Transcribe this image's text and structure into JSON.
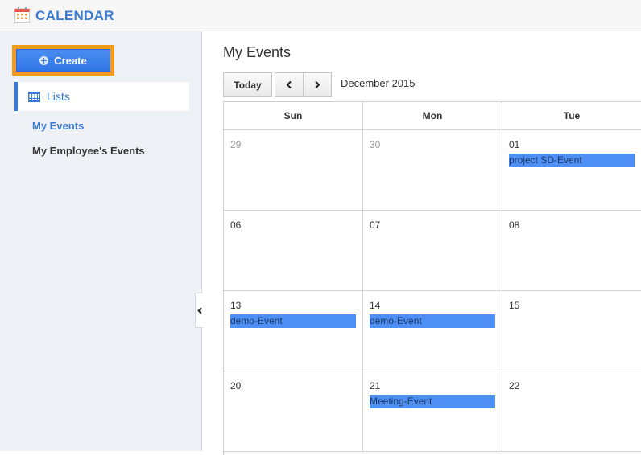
{
  "header": {
    "title": "CALENDAR",
    "icon": "calendar-icon"
  },
  "sidebar": {
    "create_label": "Create",
    "lists_label": "Lists",
    "items": [
      {
        "label": "My Events",
        "active": true
      },
      {
        "label": "My Employee's Events",
        "active": false
      }
    ]
  },
  "main": {
    "title": "My Events",
    "today_label": "Today",
    "month": "December 2015",
    "weekdays": [
      "Sun",
      "Mon",
      "Tue"
    ],
    "rows": [
      [
        {
          "day": "29",
          "muted": true
        },
        {
          "day": "30",
          "muted": true
        },
        {
          "day": "01",
          "event": "project SD-Event"
        }
      ],
      [
        {
          "day": "06"
        },
        {
          "day": "07"
        },
        {
          "day": "08"
        }
      ],
      [
        {
          "day": "13",
          "event": "demo-Event"
        },
        {
          "day": "14",
          "event": "demo-Event"
        },
        {
          "day": "15"
        }
      ],
      [
        {
          "day": "20"
        },
        {
          "day": "21",
          "event": "Meeting-Event"
        },
        {
          "day": "22"
        }
      ]
    ]
  },
  "colors": {
    "accent": "#3a7bd5",
    "event": "#4d8ff5",
    "highlight": "#f29a1e"
  }
}
